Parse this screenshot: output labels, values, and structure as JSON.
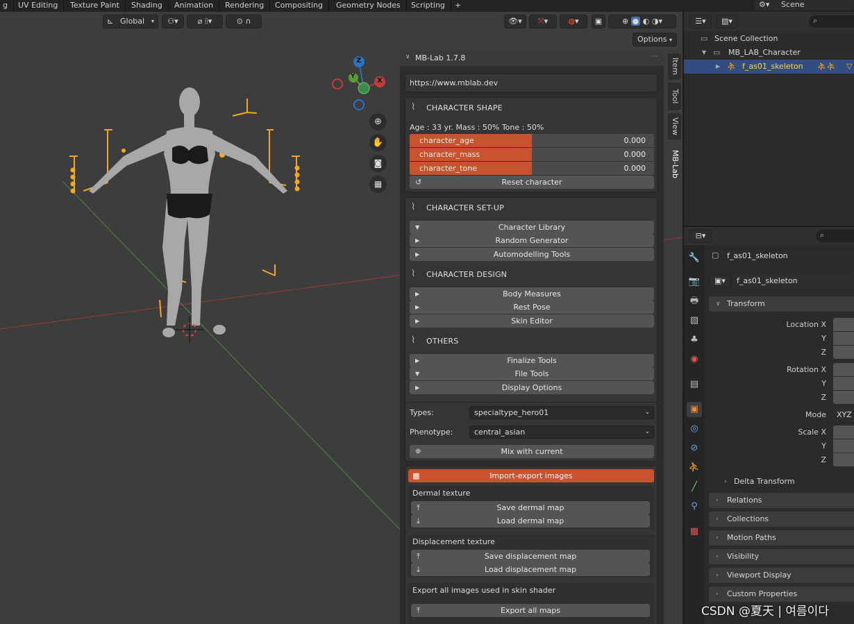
{
  "topbar": {
    "tabs": [
      "g",
      "UV Editing",
      "Texture Paint",
      "Shading",
      "Animation",
      "Rendering",
      "Compositing",
      "Geometry Nodes",
      "Scripting"
    ],
    "add_tab": "+",
    "scene_name": "Scene"
  },
  "viewport_header": {
    "transform_orientation": "Global",
    "options_label": "Options"
  },
  "gizmo": {
    "axis_z": "Z",
    "axis_x": "X",
    "axis_y": "Y"
  },
  "side_tabs": [
    "Item",
    "Tool",
    "View",
    "MB-Lab"
  ],
  "panel": {
    "title": "MB-Lab 1.7.8",
    "url": "https://www.mblab.dev",
    "character_shape": {
      "header": "CHARACTER SHAPE",
      "summary": "Age : 33 yr.  Mass : 50%  Tone : 50%",
      "sliders": [
        {
          "label": "character_age",
          "value": "0.000",
          "fill_fraction": 0.5
        },
        {
          "label": "character_mass",
          "value": "0.000",
          "fill_fraction": 0.5
        },
        {
          "label": "character_tone",
          "value": "0.000",
          "fill_fraction": 0.5
        }
      ],
      "reset_button": "Reset character"
    },
    "character_setup": {
      "header": "CHARACTER SET-UP",
      "items": [
        {
          "label": "Character Library",
          "expanded": true
        },
        {
          "label": "Random Generator",
          "expanded": false
        },
        {
          "label": "Automodelling Tools",
          "expanded": false
        }
      ]
    },
    "character_design": {
      "header": "CHARACTER DESIGN",
      "items": [
        {
          "label": "Body Measures",
          "expanded": false
        },
        {
          "label": "Rest Pose",
          "expanded": false
        },
        {
          "label": "Skin Editor",
          "expanded": false
        }
      ]
    },
    "others": {
      "header": "OTHERS",
      "items": [
        {
          "label": "Finalize Tools",
          "expanded": false
        },
        {
          "label": "File Tools",
          "expanded": true
        },
        {
          "label": "Display Options",
          "expanded": false
        }
      ]
    },
    "library": {
      "types_label": "Types:",
      "types_value": "specialtype_hero01",
      "phenotype_label": "Phenotype:",
      "phenotype_value": "central_asian",
      "mix_button": "Mix with current"
    },
    "import_export": {
      "header": "Import-export images",
      "dermal_label": "Dermal texture",
      "save_dermal": "Save dermal map",
      "load_dermal": "Load dermal map",
      "displacement_label": "Displacement texture",
      "save_displacement": "Save displacement map",
      "load_displacement": "Load displacement map",
      "export_all_label": "Export all images used in skin shader",
      "export_all_button": "Export all maps"
    }
  },
  "outliner": {
    "rows": [
      {
        "label": "Scene Collection"
      },
      {
        "label": "MB_LAB_Character"
      },
      {
        "label": "f_as01_skeleton"
      }
    ]
  },
  "properties": {
    "object_name": "f_as01_skeleton",
    "object_field": "f_as01_skeleton",
    "transform": {
      "header": "Transform",
      "location_x": "Location X",
      "y1": "Y",
      "z1": "Z",
      "rotation_x": "Rotation X",
      "y2": "Y",
      "z2": "Z",
      "mode_label": "Mode",
      "mode_value": "XYZ",
      "scale_x": "Scale X",
      "y3": "Y",
      "z3": "Z",
      "delta": "Delta Transform"
    },
    "sections": [
      "Relations",
      "Collections",
      "Motion Paths",
      "Visibility",
      "Viewport Display",
      "Custom Properties"
    ]
  },
  "watermark": "CSDN @夏天 | 여름이다",
  "colors": {
    "accent": "#c8532e",
    "outliner_highlight": "#334d80",
    "bone": "#f5a623"
  }
}
